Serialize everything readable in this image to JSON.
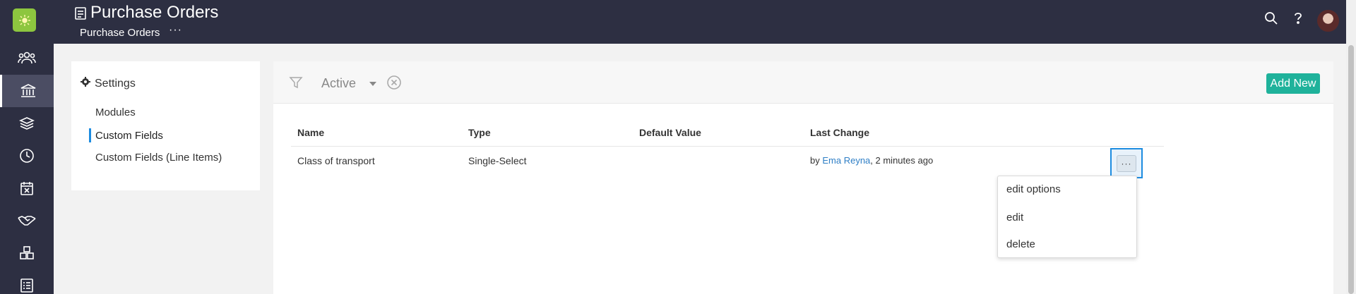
{
  "header": {
    "title": "Purchase Orders",
    "breadcrumb": "Purchase Orders",
    "breadcrumb_more": "···"
  },
  "rail": {
    "icons": [
      "logo-icon",
      "people-icon",
      "bank-icon",
      "layers-icon",
      "clock-icon",
      "calendar-x-icon",
      "handshake-icon",
      "boxes-icon",
      "list-icon"
    ],
    "active": "bank-icon"
  },
  "settings": {
    "heading": "Settings",
    "items": [
      {
        "label": "Modules"
      },
      {
        "label": "Custom Fields"
      },
      {
        "label": "Custom Fields (Line Items)"
      }
    ],
    "active_index": 1
  },
  "filter": {
    "selected": "Active"
  },
  "toolbar": {
    "add_label": "Add New"
  },
  "table": {
    "columns": [
      "Name",
      "Type",
      "Default Value",
      "Last Change"
    ],
    "rows": [
      {
        "name": "Class of transport",
        "type": "Single-Select",
        "default_value": "",
        "last_change_prefix": "by",
        "last_change_user": "Ema Reyna",
        "last_change_time": ", 2 minutes ago"
      }
    ],
    "row_menu_label": "···"
  },
  "row_menu": {
    "options": [
      {
        "label": "edit options"
      },
      {
        "label": "edit"
      },
      {
        "label": "delete"
      }
    ]
  },
  "colors": {
    "nav_bg": "#2d2f42",
    "accent": "#1fb29b",
    "link": "#2f7fc6",
    "focus": "#1d8ce0"
  }
}
